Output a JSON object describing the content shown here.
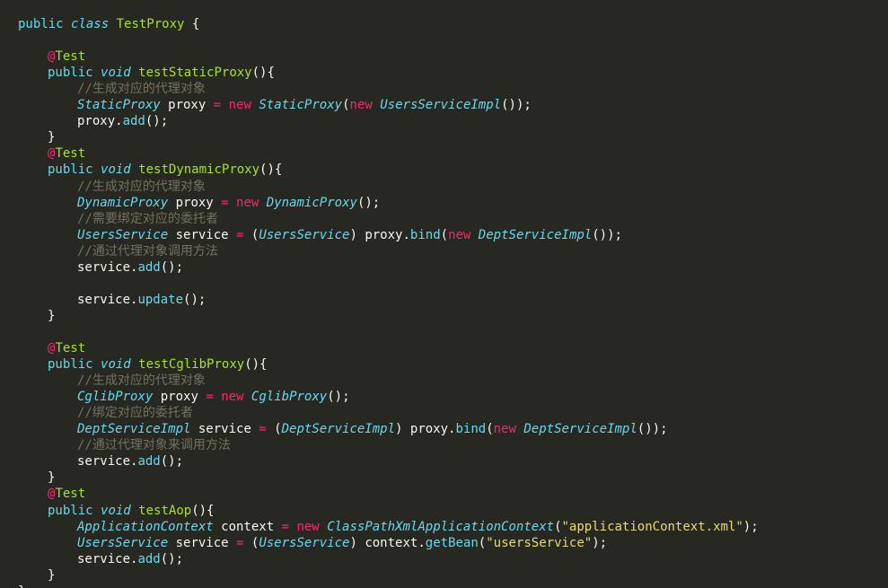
{
  "editor": {
    "language": "java",
    "theme_colors": {
      "background": "#272822",
      "foreground": "#f8f8f2",
      "keyword": "#66d9ef",
      "function_name": "#a6e22e",
      "operator": "#f92672",
      "comment": "#75715e",
      "string": "#e6db74"
    },
    "lines": [
      {
        "indent": 0,
        "tokens": [
          {
            "t": "kw",
            "v": "public "
          },
          {
            "t": "kwi",
            "v": "class "
          },
          {
            "t": "fn",
            "v": "TestProxy"
          },
          {
            "t": "plain",
            "v": " {"
          }
        ]
      },
      {
        "indent": 0,
        "tokens": []
      },
      {
        "indent": 1,
        "tokens": [
          {
            "t": "ann-at",
            "v": "@"
          },
          {
            "t": "ann",
            "v": "Test"
          }
        ]
      },
      {
        "indent": 1,
        "tokens": [
          {
            "t": "kw",
            "v": "public "
          },
          {
            "t": "kwi",
            "v": "void "
          },
          {
            "t": "fn",
            "v": "testStaticProxy"
          },
          {
            "t": "plain",
            "v": "(){"
          }
        ]
      },
      {
        "indent": 2,
        "tokens": [
          {
            "t": "cmt",
            "v": "//生成对应的代理对象"
          }
        ]
      },
      {
        "indent": 2,
        "tokens": [
          {
            "t": "type",
            "v": "StaticProxy"
          },
          {
            "t": "plain",
            "v": " proxy "
          },
          {
            "t": "op",
            "v": "="
          },
          {
            "t": "plain",
            "v": " "
          },
          {
            "t": "op",
            "v": "new"
          },
          {
            "t": "plain",
            "v": " "
          },
          {
            "t": "type",
            "v": "StaticProxy"
          },
          {
            "t": "plain",
            "v": "("
          },
          {
            "t": "op",
            "v": "new"
          },
          {
            "t": "plain",
            "v": " "
          },
          {
            "t": "type",
            "v": "UsersServiceImpl"
          },
          {
            "t": "plain",
            "v": "());"
          }
        ]
      },
      {
        "indent": 2,
        "tokens": [
          {
            "t": "plain",
            "v": "proxy."
          },
          {
            "t": "call",
            "v": "add"
          },
          {
            "t": "plain",
            "v": "();"
          }
        ]
      },
      {
        "indent": 1,
        "tokens": [
          {
            "t": "plain",
            "v": "}"
          }
        ]
      },
      {
        "indent": 1,
        "tokens": [
          {
            "t": "ann-at",
            "v": "@"
          },
          {
            "t": "ann",
            "v": "Test"
          }
        ]
      },
      {
        "indent": 1,
        "tokens": [
          {
            "t": "kw",
            "v": "public "
          },
          {
            "t": "kwi",
            "v": "void "
          },
          {
            "t": "fn",
            "v": "testDynamicProxy"
          },
          {
            "t": "plain",
            "v": "(){"
          }
        ]
      },
      {
        "indent": 2,
        "tokens": [
          {
            "t": "cmt",
            "v": "//生成对应的代理对象"
          }
        ]
      },
      {
        "indent": 2,
        "tokens": [
          {
            "t": "type",
            "v": "DynamicProxy"
          },
          {
            "t": "plain",
            "v": " proxy "
          },
          {
            "t": "op",
            "v": "="
          },
          {
            "t": "plain",
            "v": " "
          },
          {
            "t": "op",
            "v": "new"
          },
          {
            "t": "plain",
            "v": " "
          },
          {
            "t": "type",
            "v": "DynamicProxy"
          },
          {
            "t": "plain",
            "v": "();"
          }
        ]
      },
      {
        "indent": 2,
        "tokens": [
          {
            "t": "cmt",
            "v": "//需要绑定对应的委托者"
          }
        ]
      },
      {
        "indent": 2,
        "tokens": [
          {
            "t": "type",
            "v": "UsersService"
          },
          {
            "t": "plain",
            "v": " service "
          },
          {
            "t": "op",
            "v": "="
          },
          {
            "t": "plain",
            "v": " ("
          },
          {
            "t": "type",
            "v": "UsersService"
          },
          {
            "t": "plain",
            "v": ") proxy."
          },
          {
            "t": "call",
            "v": "bind"
          },
          {
            "t": "plain",
            "v": "("
          },
          {
            "t": "op",
            "v": "new"
          },
          {
            "t": "plain",
            "v": " "
          },
          {
            "t": "type",
            "v": "DeptServiceImpl"
          },
          {
            "t": "plain",
            "v": "());"
          }
        ]
      },
      {
        "indent": 2,
        "tokens": [
          {
            "t": "cmt",
            "v": "//通过代理对象调用方法"
          }
        ]
      },
      {
        "indent": 2,
        "tokens": [
          {
            "t": "plain",
            "v": "service."
          },
          {
            "t": "call",
            "v": "add"
          },
          {
            "t": "plain",
            "v": "();"
          }
        ]
      },
      {
        "indent": 0,
        "tokens": []
      },
      {
        "indent": 2,
        "tokens": [
          {
            "t": "plain",
            "v": "service."
          },
          {
            "t": "call",
            "v": "update"
          },
          {
            "t": "plain",
            "v": "();"
          }
        ]
      },
      {
        "indent": 1,
        "tokens": [
          {
            "t": "plain",
            "v": "}"
          }
        ]
      },
      {
        "indent": 0,
        "tokens": []
      },
      {
        "indent": 1,
        "tokens": [
          {
            "t": "ann-at",
            "v": "@"
          },
          {
            "t": "ann",
            "v": "Test"
          }
        ]
      },
      {
        "indent": 1,
        "tokens": [
          {
            "t": "kw",
            "v": "public "
          },
          {
            "t": "kwi",
            "v": "void "
          },
          {
            "t": "fn",
            "v": "testCglibProxy"
          },
          {
            "t": "plain",
            "v": "(){"
          }
        ]
      },
      {
        "indent": 2,
        "tokens": [
          {
            "t": "cmt",
            "v": "//生成对应的代理对象"
          }
        ]
      },
      {
        "indent": 2,
        "tokens": [
          {
            "t": "type",
            "v": "CglibProxy"
          },
          {
            "t": "plain",
            "v": " proxy "
          },
          {
            "t": "op",
            "v": "="
          },
          {
            "t": "plain",
            "v": " "
          },
          {
            "t": "op",
            "v": "new"
          },
          {
            "t": "plain",
            "v": " "
          },
          {
            "t": "type",
            "v": "CglibProxy"
          },
          {
            "t": "plain",
            "v": "();"
          }
        ]
      },
      {
        "indent": 2,
        "tokens": [
          {
            "t": "cmt",
            "v": "//绑定对应的委托者"
          }
        ]
      },
      {
        "indent": 2,
        "tokens": [
          {
            "t": "type",
            "v": "DeptServiceImpl"
          },
          {
            "t": "plain",
            "v": " service "
          },
          {
            "t": "op",
            "v": "="
          },
          {
            "t": "plain",
            "v": " ("
          },
          {
            "t": "type",
            "v": "DeptServiceImpl"
          },
          {
            "t": "plain",
            "v": ") proxy."
          },
          {
            "t": "call",
            "v": "bind"
          },
          {
            "t": "plain",
            "v": "("
          },
          {
            "t": "op",
            "v": "new"
          },
          {
            "t": "plain",
            "v": " "
          },
          {
            "t": "type",
            "v": "DeptServiceImpl"
          },
          {
            "t": "plain",
            "v": "());"
          }
        ]
      },
      {
        "indent": 2,
        "tokens": [
          {
            "t": "cmt",
            "v": "//通过代理对象来调用方法"
          }
        ]
      },
      {
        "indent": 2,
        "tokens": [
          {
            "t": "plain",
            "v": "service."
          },
          {
            "t": "call",
            "v": "add"
          },
          {
            "t": "plain",
            "v": "();"
          }
        ]
      },
      {
        "indent": 1,
        "tokens": [
          {
            "t": "plain",
            "v": "}"
          }
        ]
      },
      {
        "indent": 1,
        "tokens": [
          {
            "t": "ann-at",
            "v": "@"
          },
          {
            "t": "ann",
            "v": "Test"
          }
        ]
      },
      {
        "indent": 1,
        "tokens": [
          {
            "t": "kw",
            "v": "public "
          },
          {
            "t": "kwi",
            "v": "void "
          },
          {
            "t": "fn",
            "v": "testAop"
          },
          {
            "t": "plain",
            "v": "(){"
          }
        ]
      },
      {
        "indent": 2,
        "tokens": [
          {
            "t": "type",
            "v": "ApplicationContext"
          },
          {
            "t": "plain",
            "v": " context "
          },
          {
            "t": "op",
            "v": "="
          },
          {
            "t": "plain",
            "v": " "
          },
          {
            "t": "op",
            "v": "new"
          },
          {
            "t": "plain",
            "v": " "
          },
          {
            "t": "type",
            "v": "ClassPathXmlApplicationContext"
          },
          {
            "t": "plain",
            "v": "("
          },
          {
            "t": "str",
            "v": "\"applicationContext.xml\""
          },
          {
            "t": "plain",
            "v": ");"
          }
        ]
      },
      {
        "indent": 2,
        "tokens": [
          {
            "t": "type",
            "v": "UsersService"
          },
          {
            "t": "plain",
            "v": " service "
          },
          {
            "t": "op",
            "v": "="
          },
          {
            "t": "plain",
            "v": " ("
          },
          {
            "t": "type",
            "v": "UsersService"
          },
          {
            "t": "plain",
            "v": ") context."
          },
          {
            "t": "call",
            "v": "getBean"
          },
          {
            "t": "plain",
            "v": "("
          },
          {
            "t": "str",
            "v": "\"usersService\""
          },
          {
            "t": "plain",
            "v": ");"
          }
        ]
      },
      {
        "indent": 2,
        "tokens": [
          {
            "t": "plain",
            "v": "service."
          },
          {
            "t": "call",
            "v": "add"
          },
          {
            "t": "plain",
            "v": "();"
          }
        ]
      },
      {
        "indent": 1,
        "tokens": [
          {
            "t": "plain",
            "v": "}"
          }
        ]
      },
      {
        "indent": 0,
        "tokens": [
          {
            "t": "plain",
            "v": "}"
          }
        ]
      }
    ]
  }
}
